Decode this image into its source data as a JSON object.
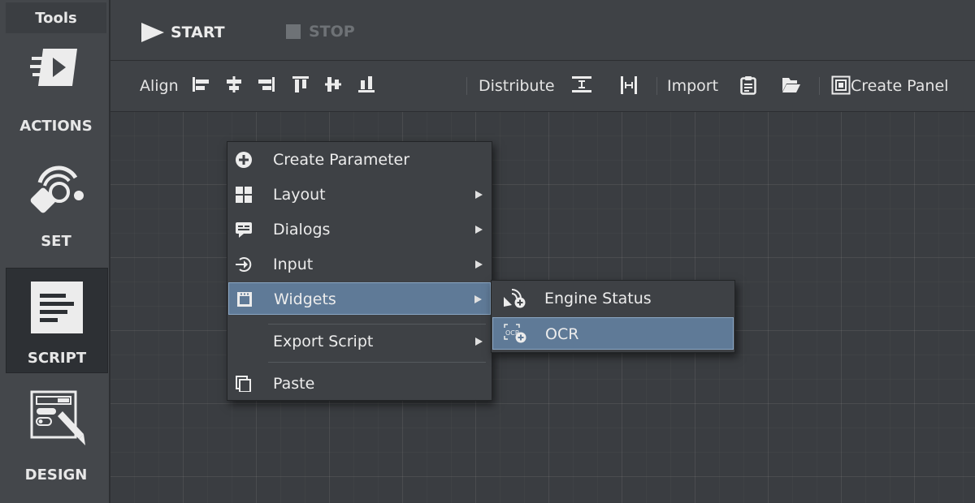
{
  "sidebar": {
    "title": "Tools",
    "items": [
      {
        "label": "ACTIONS",
        "icon": "actions-icon"
      },
      {
        "label": "SET",
        "icon": "set-icon"
      },
      {
        "label": "SCRIPT",
        "icon": "script-icon",
        "active": true
      },
      {
        "label": "DESIGN",
        "icon": "design-icon"
      }
    ]
  },
  "runbar": {
    "start_label": "START",
    "stop_label": "STOP"
  },
  "toolbar": {
    "align_label": "Align",
    "distribute_label": "Distribute",
    "import_label": "Import",
    "create_panel_label": "Create Panel"
  },
  "context_menu": {
    "items": [
      {
        "label": "Create Parameter",
        "icon": "plus-circle-icon"
      },
      {
        "label": "Layout",
        "icon": "layout-grid-icon",
        "submenu": true
      },
      {
        "label": "Dialogs",
        "icon": "dialog-icon",
        "submenu": true
      },
      {
        "label": "Input",
        "icon": "input-icon",
        "submenu": true
      },
      {
        "label": "Widgets",
        "icon": "widget-icon",
        "submenu": true,
        "highlighted": true
      },
      {
        "label": "Export Script",
        "icon": "",
        "submenu": true
      },
      {
        "label": "Paste",
        "icon": "paste-icon"
      }
    ]
  },
  "widgets_submenu": {
    "items": [
      {
        "label": "Engine Status",
        "icon": "engine-status-add-icon"
      },
      {
        "label": "OCR",
        "icon": "ocr-add-icon",
        "highlighted": true
      }
    ]
  },
  "colors": {
    "background": "#3a3d41",
    "highlight": "#5f7a97",
    "text": "#ececec",
    "disabled": "#6e7276"
  }
}
